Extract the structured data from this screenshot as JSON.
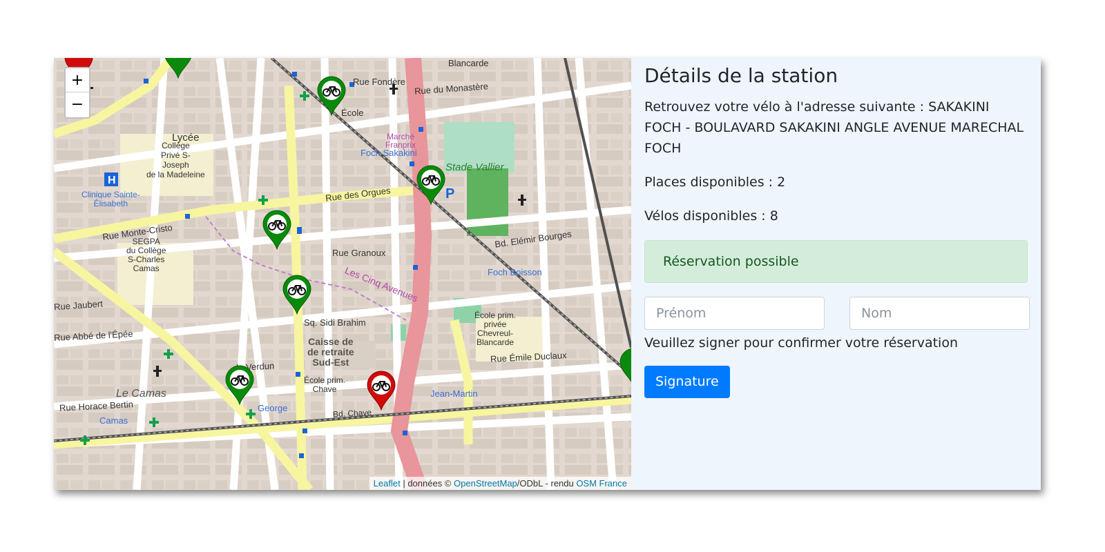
{
  "map": {
    "zoom_in": "+",
    "zoom_out": "−",
    "attribution": {
      "leaflet": "Leaflet",
      "middle": " | données © ",
      "osm": "OpenStreetMap",
      "license": "/ODbL - rendu ",
      "osm_france": "OSM France"
    },
    "labels": {
      "rue_fondere": "Rue Fondère",
      "rue_monastere": "Rue du Monastère",
      "blancarde": "Blancarde",
      "ecole_top": "École",
      "lycee": "Lycée",
      "college": "Collège\nPrivé S‑\nJoseph\nde la Madeleine",
      "clinique": "Clinique Sainte-\nÉlisabeth",
      "stade": "Stade Vallier",
      "rue_orgues": "Rue des Orgues",
      "rue_monte_cristo": "Rue Monte-Cristo",
      "segpa": "SEGPA\ndu Collège\nS‑Charles\nCamas",
      "rue_granoux": "Rue Granoux",
      "bd_eleminr": "Bd. Elémir Bourges",
      "foch_boisson": "Foch Boisson",
      "rue_jaubert": "Rue Jaubert",
      "cinq_avenues": "Les Cinq Avenues",
      "sq_sidi": "Sq. Sidi Brahim",
      "caisse": "Caisse de\nde retraite\nSud-Est",
      "rue_abbe": "Rue Abbé de l'Épée",
      "rue_verdun": "de Verdun",
      "ecole_chave": "École prim.\nChave",
      "ecole_cheverul": "École prim.\nprivée\nChevreul-\nBlancarde",
      "rue_emile": "Rue Émile Duclaux",
      "le_camas": "Le Camas",
      "rue_horace": "Rue Horace Bertin",
      "jean_martin": "Jean-Martin",
      "bd_chave": "Bd. Chave",
      "foch_sakakini": "Foch Sakakini",
      "marche": "Marché\nFranprix",
      "camas": "Camas",
      "george": "George"
    }
  },
  "panel": {
    "title": "Détails de la station",
    "address_prefix": "Retrouvez votre vélo à l'adresse suivante : ",
    "address": "SAKAKINI FOCH - BOULAVARD SAKAKINI ANGLE AVENUE MARECHAL FOCH",
    "places_label": "Places disponibles : ",
    "places_value": "2",
    "velos_label": "Vélos disponibles : ",
    "velos_value": "8",
    "status": "Réservation possible",
    "status_color": "#d4edda",
    "firstname_placeholder": "Prénom",
    "lastname_placeholder": "Nom",
    "sign_instruction": "Veuillez signer pour confirmer votre réservation",
    "signature_button": "Signature",
    "button_color": "#007bff"
  }
}
